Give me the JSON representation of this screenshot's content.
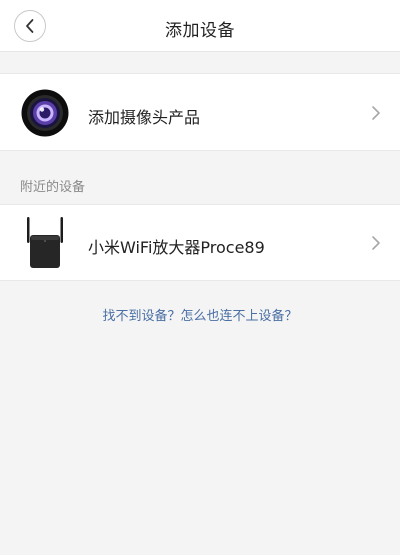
{
  "header": {
    "title": "添加设备"
  },
  "camera_row": {
    "label": "添加摄像头产品"
  },
  "nearby": {
    "section_label": "附近的设备",
    "devices": [
      {
        "label": "小米WiFi放大器Proce89"
      }
    ]
  },
  "help": {
    "link_text": "找不到设备？怎么也连不上设备？"
  },
  "colors": {
    "accent_link": "#4a6fa5",
    "background": "#f4f4f4"
  }
}
